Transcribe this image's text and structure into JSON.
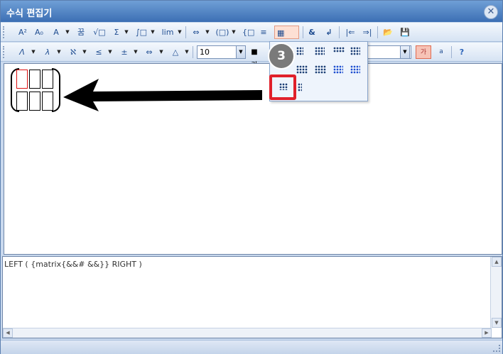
{
  "window": {
    "title": "수식 편집기",
    "close_glyph": "✕"
  },
  "toolbar1": {
    "buttons": [
      {
        "name": "superscript-button",
        "label": "A²"
      },
      {
        "name": "subscript-button",
        "label": "A₀"
      },
      {
        "name": "accent-button",
        "label": "A"
      },
      {
        "name": "fraction-button",
        "label": "꿈"
      },
      {
        "name": "root-button",
        "label": "√□"
      },
      {
        "name": "sum-button",
        "label": "Σ"
      },
      {
        "name": "integral-button",
        "label": "∫□"
      },
      {
        "name": "limit-button",
        "label": "lim"
      },
      {
        "name": "arrow-box-button",
        "label": "⇔"
      },
      {
        "name": "bracket-button",
        "label": "(□)"
      },
      {
        "name": "case-button",
        "label": "{□"
      },
      {
        "name": "stack-button",
        "label": "≡"
      },
      {
        "name": "matrix-button",
        "label": "▦"
      },
      {
        "name": "ampersand-button",
        "label": "&"
      },
      {
        "name": "newline-button",
        "label": "↲"
      },
      {
        "name": "move-prev-button",
        "label": "|⇐"
      },
      {
        "name": "move-next-button",
        "label": "⇒|"
      },
      {
        "name": "open-file-button",
        "label": "📂"
      },
      {
        "name": "save-file-button",
        "label": "💾"
      }
    ]
  },
  "toolbar2": {
    "buttons": [
      {
        "name": "greek-upper-button",
        "label": "Λ"
      },
      {
        "name": "greek-lower-button",
        "label": "λ"
      },
      {
        "name": "hebrew-button",
        "label": "ℵ"
      },
      {
        "name": "relation-button",
        "label": "≤"
      },
      {
        "name": "operator-button",
        "label": "±"
      },
      {
        "name": "arrows-button",
        "label": "⇔"
      },
      {
        "name": "shapes-button",
        "label": "△"
      }
    ],
    "font_size_value": "10",
    "color_button_label": "■가",
    "right_buttons": [
      {
        "name": "text-style-button",
        "label": "가"
      },
      {
        "name": "script-view-button",
        "label": "a"
      },
      {
        "name": "help-button",
        "label": "?"
      }
    ]
  },
  "matrix_dropdown": {
    "rows": [
      [
        "2x1",
        "2x2",
        "2x3",
        "3x3"
      ],
      [
        "3x1",
        "3x4",
        "3x4b",
        "4x4"
      ],
      [
        "3x2-selected",
        "vector"
      ]
    ]
  },
  "callout": {
    "step_number": "3"
  },
  "script": {
    "text": "LEFT ( {matrix{&&# &&}} RIGHT )"
  },
  "colors": {
    "highlight": "#e0202a",
    "title_bar": "#3c6fb4",
    "toolbar_bg": "#d6e3f3"
  }
}
